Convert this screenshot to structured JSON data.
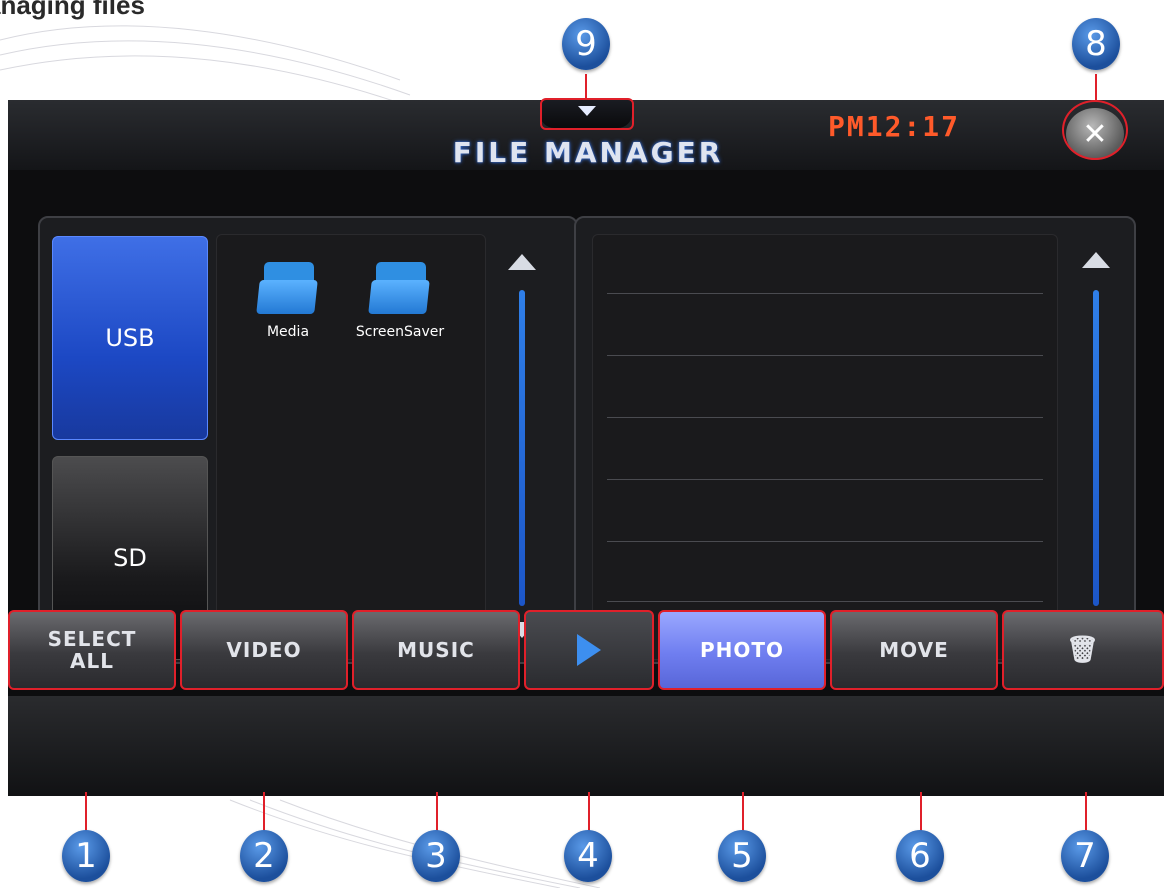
{
  "document": {
    "heading": "anaging files"
  },
  "screen": {
    "title": "FILE MANAGER",
    "clock": "PM12:17",
    "close_icon": "close-icon",
    "menu_toggle_icon": "chevron-down-icon"
  },
  "devices": [
    {
      "label": "USB",
      "selected": true
    },
    {
      "label": "SD",
      "selected": false
    }
  ],
  "folders": [
    {
      "name": "Media",
      "icon": "folder-icon"
    },
    {
      "name": "ScreenSaver",
      "icon": "folder-icon"
    }
  ],
  "toolbar": {
    "select_all": "SELECT\nALL",
    "video": "VIDEO",
    "music": "MUSIC",
    "play_icon": "play-icon",
    "photo": "PHOTO",
    "move": "MOVE",
    "delete_icon": "trash-icon"
  },
  "callouts": [
    "1",
    "2",
    "3",
    "4",
    "5",
    "6",
    "7",
    "8",
    "9"
  ],
  "colors": {
    "accent_blue": "#1c48c4",
    "photo_active": "#6f7ef0",
    "clock": "#ff5a2a",
    "highlight": "#e0202a",
    "callout": "#2a63b8"
  }
}
